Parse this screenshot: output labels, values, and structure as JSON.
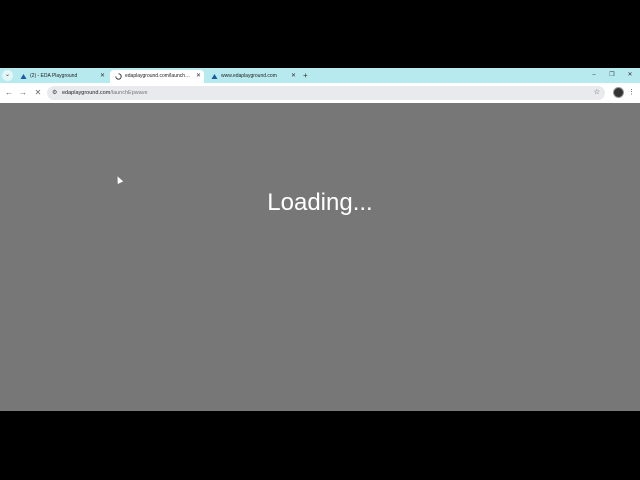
{
  "tabs": [
    {
      "title": "(2) - EDA Playground",
      "active": false,
      "icon": "eda-playground-favicon-icon"
    },
    {
      "title": "edaplayground.com/launchEpwave",
      "active": true,
      "icon": "loading-spinner-icon"
    },
    {
      "title": "www.edaplayground.com",
      "active": false,
      "icon": "eda-playground-favicon-icon"
    }
  ],
  "toolbar": {
    "url_domain": "edaplayground.com",
    "url_path": "/launchEpwave"
  },
  "content": {
    "loading_text": "Loading..."
  },
  "colors": {
    "tabbar": "#b7eaee",
    "page_background": "#777777"
  }
}
